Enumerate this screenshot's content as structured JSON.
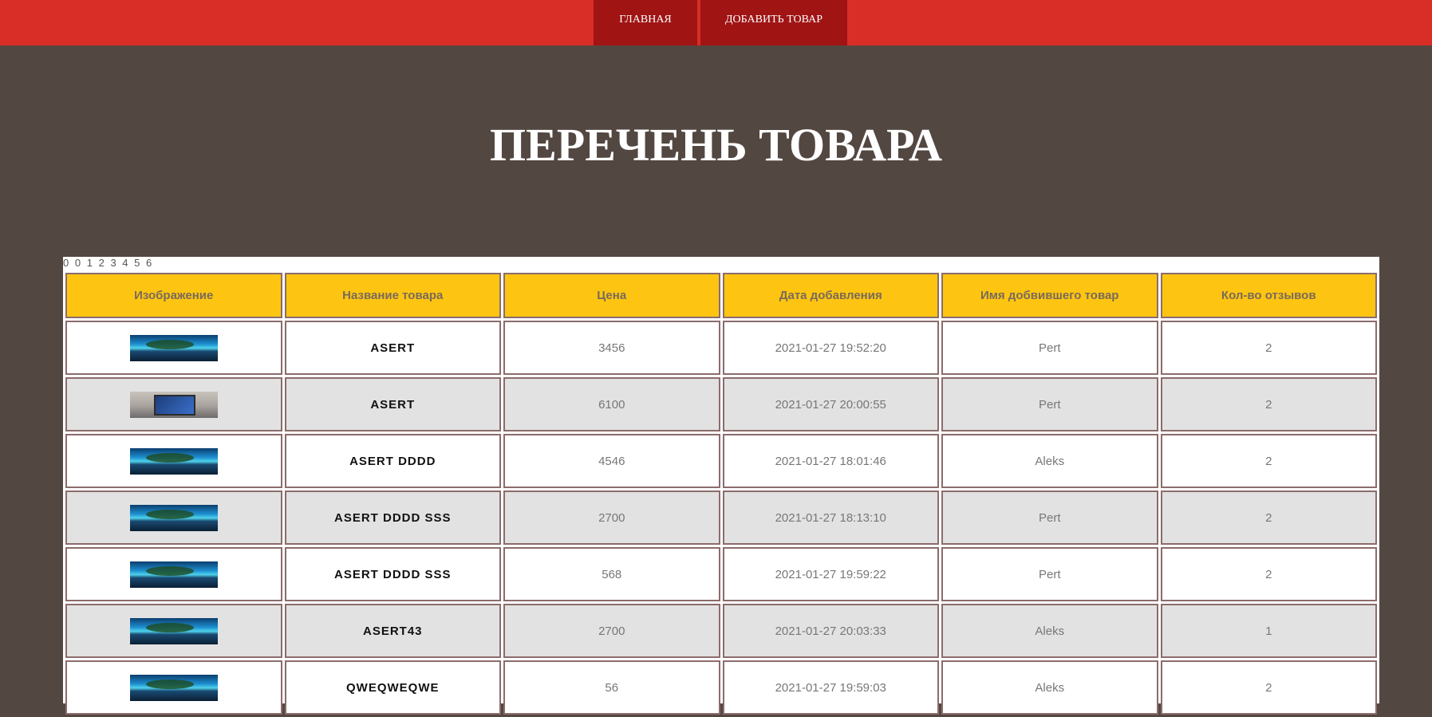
{
  "nav": {
    "home_label": "ГЛАВНАЯ",
    "add_label": "ДОБАВИТЬ ТОВАР"
  },
  "page": {
    "title": "ПЕРЕЧЕНЬ ТОВАРА"
  },
  "pager": {
    "pages": [
      "0",
      "0",
      "1",
      "2",
      "3",
      "4",
      "5",
      "6"
    ]
  },
  "table": {
    "headers": [
      "Изображение",
      "Название товара",
      "Цена",
      "Дата добавления",
      "Имя добвившего товар",
      "Кол-во отзывов"
    ],
    "rows": [
      {
        "image": "landscape",
        "name": "ASERT",
        "price": "3456",
        "date": "2021-01-27 19:52:20",
        "author": "Pert",
        "reviews": "2"
      },
      {
        "image": "laptop",
        "name": "ASERT",
        "price": "6100",
        "date": "2021-01-27 20:00:55",
        "author": "Pert",
        "reviews": "2"
      },
      {
        "image": "landscape",
        "name": "ASERT DDDD",
        "price": "4546",
        "date": "2021-01-27 18:01:46",
        "author": "Aleks",
        "reviews": "2"
      },
      {
        "image": "landscape",
        "name": "ASERT DDDD SSS",
        "price": "2700",
        "date": "2021-01-27 18:13:10",
        "author": "Pert",
        "reviews": "2"
      },
      {
        "image": "landscape",
        "name": "ASERT DDDD SSS",
        "price": "568",
        "date": "2021-01-27 19:59:22",
        "author": "Pert",
        "reviews": "2"
      },
      {
        "image": "landscape",
        "name": "ASERT43",
        "price": "2700",
        "date": "2021-01-27 20:03:33",
        "author": "Aleks",
        "reviews": "1"
      },
      {
        "image": "landscape",
        "name": "QWEQWEQWE",
        "price": "56",
        "date": "2021-01-27 19:59:03",
        "author": "Aleks",
        "reviews": "2"
      }
    ]
  },
  "colors": {
    "topbar": "#d92d27",
    "nav_button": "#a01414",
    "background": "#534741",
    "header_cell": "#fdc511",
    "row_alt": "#e2e2e2"
  }
}
